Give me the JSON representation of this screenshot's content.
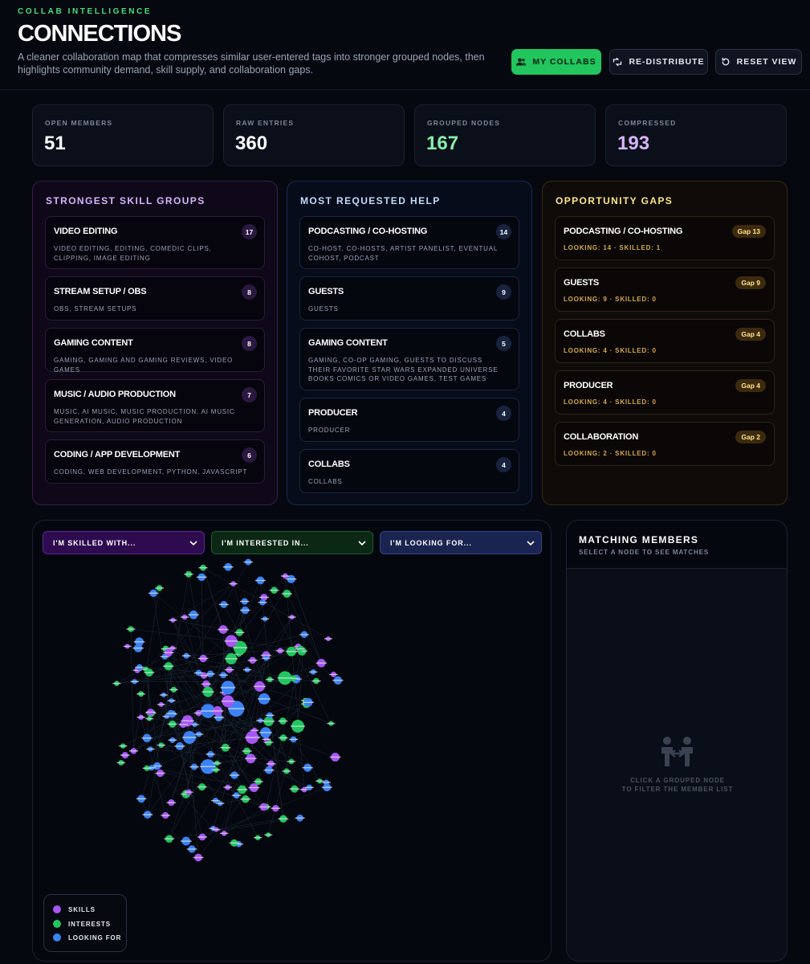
{
  "header": {
    "eyebrow": "COLLAB INTELLIGENCE",
    "title": "CONNECTIONS",
    "subtitle": "A cleaner collaboration map that compresses similar user-entered tags into stronger grouped nodes, then highlights community demand, skill supply, and collaboration gaps.",
    "buttons": {
      "my_collabs": "MY COLLABS",
      "redistribute": "RE-DISTRIBUTE",
      "reset": "RESET VIEW"
    }
  },
  "stats": [
    {
      "label": "OPEN MEMBERS",
      "value": "51",
      "color": "#ffffff"
    },
    {
      "label": "RAW ENTRIES",
      "value": "360",
      "color": "#ffffff"
    },
    {
      "label": "GROUPED NODES",
      "value": "167",
      "color": "#86efac"
    },
    {
      "label": "COMPRESSED",
      "value": "193",
      "color": "#d8b4fe"
    }
  ],
  "skills_panel": {
    "title": "STRONGEST SKILL GROUPS",
    "items": [
      {
        "name": "VIDEO EDITING",
        "count": "17",
        "tags": "VIDEO EDITING, EDITING, COMEDIC CLIPS, CLIPPING, IMAGE EDITING"
      },
      {
        "name": "STREAM SETUP / OBS",
        "count": "8",
        "tags": "OBS, STREAM SETUPS"
      },
      {
        "name": "GAMING CONTENT",
        "count": "8",
        "tags": "GAMING, GAMING AND GAMING REVIEWS, VIDEO GAMES"
      },
      {
        "name": "MUSIC / AUDIO PRODUCTION",
        "count": "7",
        "tags": "MUSIC, AI MUSIC, MUSIC PRODUCTION, AI MUSIC GENERATION, AUDIO PRODUCTION"
      },
      {
        "name": "CODING / APP DEVELOPMENT",
        "count": "6",
        "tags": "CODING, WEB DEVELOPMENT, PYTHON, JAVASCRIPT"
      }
    ]
  },
  "help_panel": {
    "title": "MOST REQUESTED HELP",
    "items": [
      {
        "name": "PODCASTING / CO-HOSTING",
        "count": "14",
        "tags": "CO-HOST, CO-HOSTS, ARTIST PANELIST, EVENTUAL COHOST, PODCAST"
      },
      {
        "name": "GUESTS",
        "count": "9",
        "tags": "GUESTS"
      },
      {
        "name": "GAMING CONTENT",
        "count": "5",
        "tags": "GAMING, CO-OP GAMING, GUESTS TO DISCUSS THEIR FAVORITE STAR WARS EXPANDED UNIVERSE BOOKS COMICS OR VIDEO GAMES, TEST GAMES"
      },
      {
        "name": "PRODUCER",
        "count": "4",
        "tags": "PRODUCER"
      },
      {
        "name": "COLLABS",
        "count": "4",
        "tags": "COLLABS"
      }
    ]
  },
  "gaps_panel": {
    "title": "OPPORTUNITY GAPS",
    "items": [
      {
        "name": "PODCASTING / CO-HOSTING",
        "badge": "Gap 13",
        "detail": "LOOKING: 14 · SKILLED: 1"
      },
      {
        "name": "GUESTS",
        "badge": "Gap 9",
        "detail": "LOOKING: 9 · SKILLED: 0"
      },
      {
        "name": "COLLABS",
        "badge": "Gap 4",
        "detail": "LOOKING: 4 · SKILLED: 0"
      },
      {
        "name": "PRODUCER",
        "badge": "Gap 4",
        "detail": "LOOKING: 4 · SKILLED: 0"
      },
      {
        "name": "COLLABORATION",
        "badge": "Gap 2",
        "detail": "LOOKING: 2 · SKILLED: 0"
      }
    ]
  },
  "graph": {
    "filters": {
      "skilled": "I'M SKILLED WITH...",
      "interested": "I'M INTERESTED IN...",
      "looking": "I'M LOOKING FOR..."
    },
    "legend": [
      {
        "label": "SKILLS",
        "color": "#a855f7"
      },
      {
        "label": "INTERESTS",
        "color": "#22c55e"
      },
      {
        "label": "LOOKING FOR",
        "color": "#3b82f6"
      }
    ]
  },
  "matches": {
    "title": "MATCHING MEMBERS",
    "subtitle": "SELECT A NODE TO SEE MATCHES",
    "empty_line1": "CLICK A GROUPED NODE",
    "empty_line2": "TO FILTER THE MEMBER LIST"
  },
  "icons": {
    "my_collabs": "users-icon",
    "redistribute": "shuffle-icon",
    "reset": "rotate-icon",
    "empty": "handshake-people-icon"
  }
}
